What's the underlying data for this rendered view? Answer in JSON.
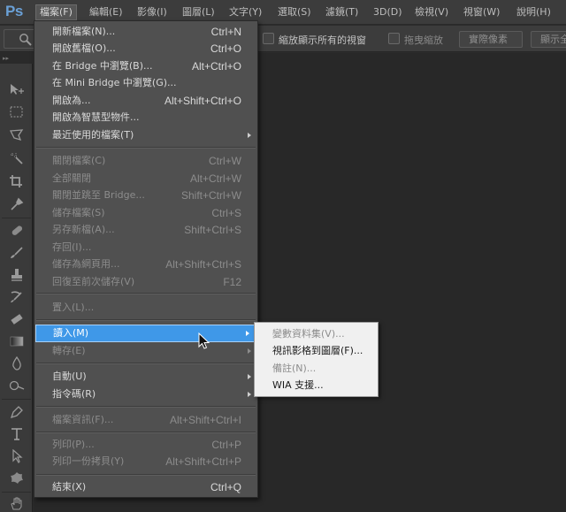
{
  "app": {
    "logo": "Ps"
  },
  "menubar": {
    "items": [
      {
        "label": "檔案(F)",
        "active": true
      },
      {
        "label": "編輯(E)"
      },
      {
        "label": "影像(I)"
      },
      {
        "label": "圖層(L)"
      },
      {
        "label": "文字(Y)"
      },
      {
        "label": "選取(S)"
      },
      {
        "label": "濾鏡(T)"
      },
      {
        "label": "3D(D)"
      },
      {
        "label": "檢視(V)"
      },
      {
        "label": "視窗(W)"
      },
      {
        "label": "說明(H)"
      }
    ]
  },
  "options_bar": {
    "tool_icon": "zoom-icon",
    "zoom_all_windows": {
      "label": "縮放顯示所有的視窗",
      "checked": false
    },
    "scrubby_zoom": {
      "label": "拖曳縮放",
      "checked": false,
      "disabled": true
    },
    "actual_pixels_button": "實際像素",
    "fit_screen_button": "顯示全"
  },
  "toolbar": {
    "header": "▸▸",
    "tools": [
      {
        "name": "move-tool",
        "icon": "move-icon"
      },
      {
        "name": "rectangular-marquee-tool",
        "icon": "marquee-icon"
      },
      {
        "name": "lasso-tool",
        "icon": "lasso-icon"
      },
      {
        "name": "quick-selection-tool",
        "icon": "magic-wand-icon"
      },
      {
        "name": "crop-tool",
        "icon": "crop-icon"
      },
      {
        "name": "eyedropper-tool",
        "icon": "eyedropper-icon"
      },
      {
        "name": "healing-brush-tool",
        "icon": "bandage-icon"
      },
      {
        "name": "brush-tool",
        "icon": "brush-icon"
      },
      {
        "name": "clone-stamp-tool",
        "icon": "stamp-icon"
      },
      {
        "name": "history-brush-tool",
        "icon": "history-brush-icon"
      },
      {
        "name": "eraser-tool",
        "icon": "eraser-icon"
      },
      {
        "name": "gradient-tool",
        "icon": "gradient-icon"
      },
      {
        "name": "blur-tool",
        "icon": "droplet-icon"
      },
      {
        "name": "dodge-tool",
        "icon": "dodge-icon"
      },
      {
        "name": "pen-tool",
        "icon": "pen-icon"
      },
      {
        "name": "type-tool",
        "icon": "type-icon"
      },
      {
        "name": "path-selection-tool",
        "icon": "arrow-icon"
      },
      {
        "name": "custom-shape-tool",
        "icon": "shape-icon"
      },
      {
        "name": "hand-tool",
        "icon": "hand-icon"
      }
    ]
  },
  "file_menu": {
    "items": [
      {
        "label": "開新檔案(N)...",
        "shortcut": "Ctrl+N"
      },
      {
        "label": "開啟舊檔(O)...",
        "shortcut": "Ctrl+O"
      },
      {
        "label": "在 Bridge 中瀏覽(B)...",
        "shortcut": "Alt+Ctrl+O"
      },
      {
        "label": "在 Mini Bridge 中瀏覽(G)...",
        "shortcut": ""
      },
      {
        "label": "開啟為...",
        "shortcut": "Alt+Shift+Ctrl+O"
      },
      {
        "label": "開啟為智慧型物件...",
        "shortcut": ""
      },
      {
        "label": "最近使用的檔案(T)",
        "shortcut": "",
        "submenu": true
      },
      {
        "label": "關閉檔案(C)",
        "shortcut": "Ctrl+W",
        "disabled": true
      },
      {
        "label": "全部關閉",
        "shortcut": "Alt+Ctrl+W",
        "disabled": true
      },
      {
        "label": "關閉並跳至 Bridge...",
        "shortcut": "Shift+Ctrl+W",
        "disabled": true
      },
      {
        "label": "儲存檔案(S)",
        "shortcut": "Ctrl+S",
        "disabled": true
      },
      {
        "label": "另存新檔(A)...",
        "shortcut": "Shift+Ctrl+S",
        "disabled": true
      },
      {
        "label": "存回(I)...",
        "shortcut": "",
        "disabled": true
      },
      {
        "label": "儲存為網頁用...",
        "shortcut": "Alt+Shift+Ctrl+S",
        "disabled": true
      },
      {
        "label": "回復至前次儲存(V)",
        "shortcut": "F12",
        "disabled": true
      },
      {
        "label": "置入(L)...",
        "shortcut": "",
        "disabled": true
      },
      {
        "label": "讀入(M)",
        "shortcut": "",
        "submenu": true,
        "highlighted": true
      },
      {
        "label": "轉存(E)",
        "shortcut": "",
        "submenu": true,
        "disabled": true
      },
      {
        "label": "自動(U)",
        "shortcut": "",
        "submenu": true
      },
      {
        "label": "指令碼(R)",
        "shortcut": "",
        "submenu": true
      },
      {
        "label": "檔案資訊(F)...",
        "shortcut": "Alt+Shift+Ctrl+I",
        "disabled": true
      },
      {
        "label": "列印(P)...",
        "shortcut": "Ctrl+P",
        "disabled": true
      },
      {
        "label": "列印一份拷貝(Y)",
        "shortcut": "Alt+Shift+Ctrl+P",
        "disabled": true
      },
      {
        "label": "結束(X)",
        "shortcut": "Ctrl+Q"
      }
    ]
  },
  "import_submenu": {
    "items": [
      {
        "label": "變數資料集(V)...",
        "disabled": true
      },
      {
        "label": "視訊影格到圖層(F)..."
      },
      {
        "label": "備註(N)...",
        "disabled": true
      },
      {
        "label": "WIA 支援..."
      }
    ]
  },
  "colors": {
    "highlight": "#3f98e8",
    "menu_bg": "#505050",
    "submenu_bg": "#f0f0f0",
    "app_bg": "#282828",
    "logo": "#6aa0d6"
  }
}
